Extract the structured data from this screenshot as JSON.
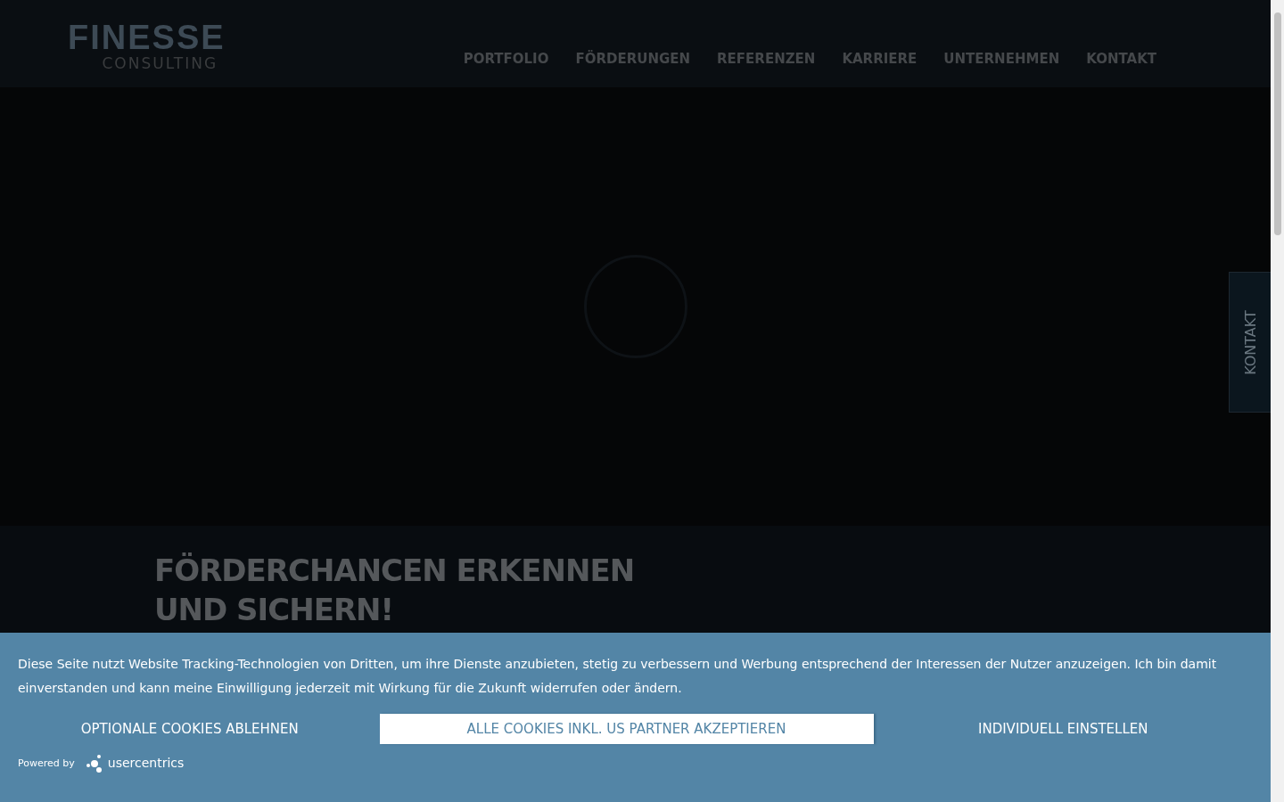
{
  "header": {
    "logo": {
      "name": "FINESSE",
      "tagline": "CONSULTING"
    },
    "nav": [
      "PORTFOLIO",
      "FÖRDERUNGEN",
      "REFERENZEN",
      "KARRIERE",
      "UNTERNEHMEN",
      "KONTAKT"
    ]
  },
  "side_tab": "KONTAKT",
  "heading": "FÖRDERCHANCEN ERKENNEN UND SICHERN!",
  "cookie_banner": {
    "text": "Diese Seite nutzt Website Tracking-Technologien von Dritten, um ihre Dienste anzubieten, stetig zu verbessern und Werbung entsprechend der Interessen der Nutzer anzuzeigen. Ich bin damit einverstanden und kann meine Einwilligung jederzeit mit Wirkung für die Zukunft widerrufen oder ändern.",
    "buttons": [
      {
        "label": "OPTIONALE COOKIES ABLEHNEN",
        "kind": "text"
      },
      {
        "label": "ALLE COOKIES INKL. US PARTNER AKZEPTIEREN",
        "kind": "primary"
      },
      {
        "label": "INDIVIDUELL EINSTELLEN",
        "kind": "text"
      }
    ],
    "powered_by": "Powered by",
    "brand": "usercentrics"
  }
}
